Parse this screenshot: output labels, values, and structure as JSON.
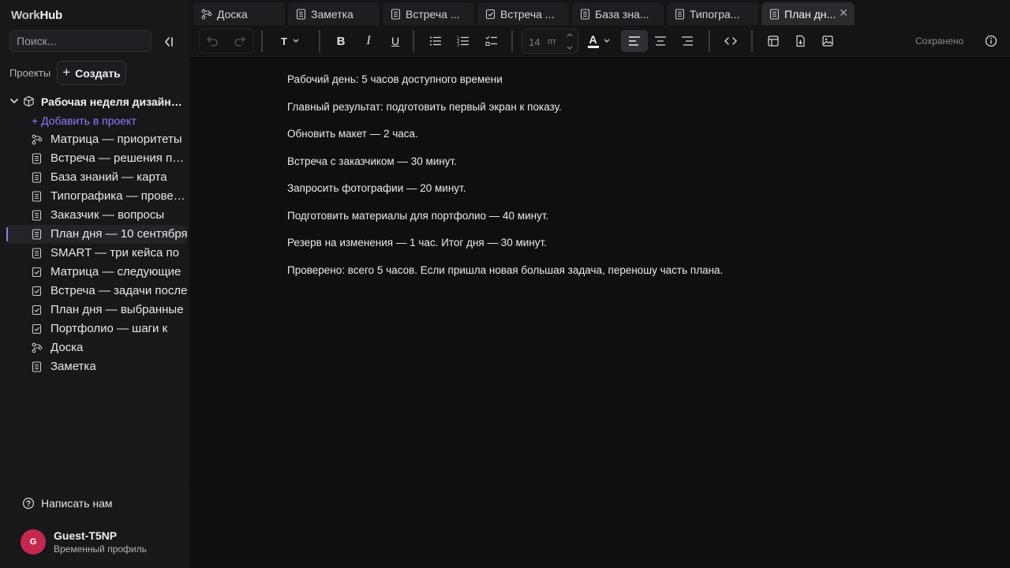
{
  "app": {
    "logo_work": "Work",
    "logo_hub": "Hub"
  },
  "sidebar": {
    "search_placeholder": "Поиск...",
    "projects_label": "Проекты",
    "create_label": "Создать",
    "project_title": "Рабочая неделя дизайнера",
    "add_to_project": "+ Добавить в проект",
    "items": [
      {
        "label": "Матрица — приоритеты",
        "icon": "board-icon"
      },
      {
        "label": "Встреча — решения по проекту",
        "icon": "note-icon"
      },
      {
        "label": "База знаний — карта",
        "icon": "note-icon"
      },
      {
        "label": "Типографика — проверка",
        "icon": "note-icon"
      },
      {
        "label": "Заказчик — вопросы",
        "icon": "note-icon"
      },
      {
        "label": "План дня — 10 сентября",
        "icon": "note-icon",
        "active": true
      },
      {
        "label": "SMART — три кейса по",
        "icon": "note-icon"
      },
      {
        "label": "Матрица — следующие",
        "icon": "task-icon"
      },
      {
        "label": "Встреча — задачи после",
        "icon": "task-icon"
      },
      {
        "label": "План дня — выбранные",
        "icon": "task-icon"
      },
      {
        "label": "Портфолио — шаги к",
        "icon": "task-icon"
      },
      {
        "label": "Доска",
        "icon": "board-icon"
      },
      {
        "label": "Заметка",
        "icon": "note-icon"
      }
    ],
    "contact_label": "Написать нам",
    "user": {
      "initial": "G",
      "name": "Guest-T5NP",
      "subtitle": "Временный профиль",
      "avatar_color": "#c4284e"
    }
  },
  "tabs": [
    {
      "label": "Доска",
      "icon": "board-icon"
    },
    {
      "label": "Заметка",
      "icon": "note-icon"
    },
    {
      "label": "Встреча ...",
      "icon": "note-icon"
    },
    {
      "label": "Встреча ...",
      "icon": "task-icon"
    },
    {
      "label": "База зна...",
      "icon": "note-icon"
    },
    {
      "label": "Типогра...",
      "icon": "note-icon"
    },
    {
      "label": "План дн...",
      "icon": "note-icon",
      "active": true
    }
  ],
  "toolbar": {
    "text_style_label": "T",
    "font_size": "14",
    "font_size_unit": "пт",
    "text_color_label": "A",
    "status": "Сохранено"
  },
  "document": {
    "paragraphs": [
      "Рабочий день: 5 часов доступного времени",
      "Главный результат: подготовить первый экран к показу.",
      "Обновить макет — 2 часа.",
      "Встреча с заказчиком — 30 минут.",
      "Запросить фотографии — 20 минут.",
      "Подготовить материалы для портфолио — 40 минут.",
      "Резерв на изменения — 1 час. Итог дня — 30 минут.",
      "Проверено: всего 5 часов. Если пришла новая большая задача, переношу часть плана."
    ]
  },
  "colors": {
    "accent": "#8b7cf6",
    "background": "#0f0f11",
    "sidebar": "#18181b"
  }
}
